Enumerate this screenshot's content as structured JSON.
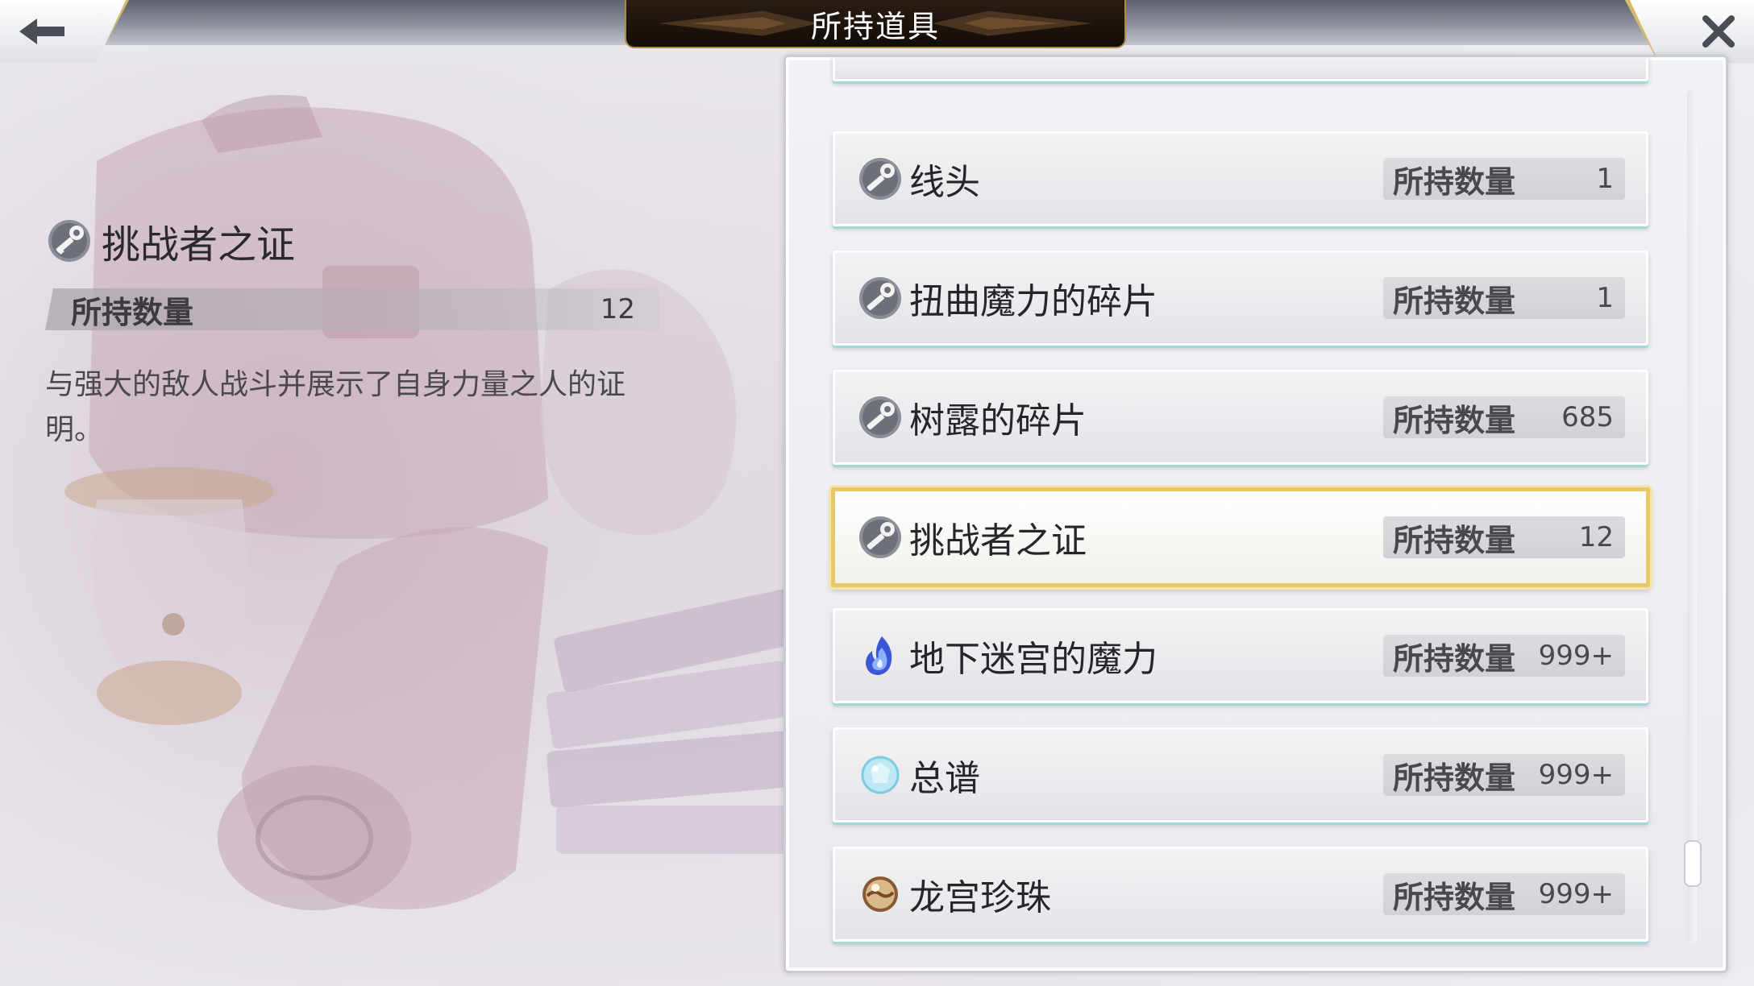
{
  "header": {
    "title": "所持道具",
    "back_icon": "arrow-left-icon",
    "close_icon": "close-icon"
  },
  "detail": {
    "icon": "key-icon",
    "name": "挑战者之证",
    "quantity_label": "所持数量",
    "quantity_value": "12",
    "description": "与强大的敌人战斗并展示了自身力量之人的证明。"
  },
  "items": [
    {
      "name": "线头",
      "icon": "key-icon",
      "quantity_label": "所持数量",
      "quantity": "1",
      "selected": false
    },
    {
      "name": "扭曲魔力的碎片",
      "icon": "key-icon",
      "quantity_label": "所持数量",
      "quantity": "1",
      "selected": false
    },
    {
      "name": "树露的碎片",
      "icon": "key-icon",
      "quantity_label": "所持数量",
      "quantity": "685",
      "selected": false
    },
    {
      "name": "挑战者之证",
      "icon": "key-icon",
      "quantity_label": "所持数量",
      "quantity": "12",
      "selected": true
    },
    {
      "name": "地下迷宫的魔力",
      "icon": "blue-flame-icon",
      "quantity_label": "所持数量",
      "quantity": "999+",
      "selected": false
    },
    {
      "name": "总谱",
      "icon": "crystal-orb-icon",
      "quantity_label": "所持数量",
      "quantity": "999+",
      "selected": false
    },
    {
      "name": "龙宫珍珠",
      "icon": "pearl-icon",
      "quantity_label": "所持数量",
      "quantity": "999+",
      "selected": false
    }
  ],
  "colors": {
    "selected_border": "#e9c86a",
    "row_underline": "#9fdad9",
    "banner_bg": "#1b130d"
  }
}
